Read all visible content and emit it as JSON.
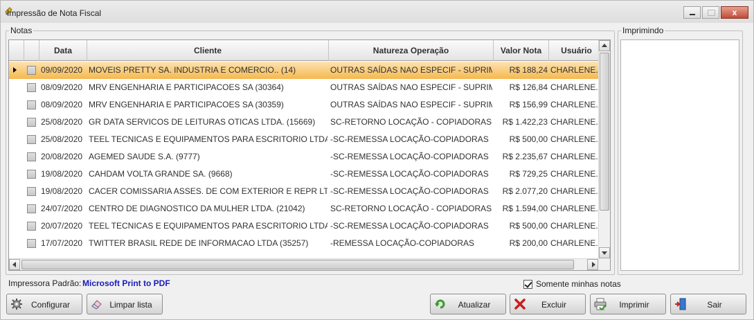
{
  "window": {
    "title": "Impressão de Nota Fiscal",
    "close_label": "x"
  },
  "notas": {
    "legend": "Notas",
    "columns": [
      "Data",
      "Cliente",
      "Natureza Operação",
      "Valor Nota",
      "Usuário"
    ],
    "rows": [
      {
        "data": "09/09/2020",
        "cliente": "MOVEIS PRETTY SA. INDUSTRIA E COMERCIO.. (14)",
        "natureza": "OUTRAS SAÍDAS NAO ESPECIF - SUPRIM...",
        "valor": "R$ 188,24",
        "usuario": "CHARLENE.M"
      },
      {
        "data": "08/09/2020",
        "cliente": "MRV ENGENHARIA E PARTICIPACOES SA (30364)",
        "natureza": "OUTRAS SAÍDAS NAO ESPECIF - SUPRIM...",
        "valor": "R$ 126,84",
        "usuario": "CHARLENE.M"
      },
      {
        "data": "08/09/2020",
        "cliente": "MRV ENGENHARIA E PARTICIPACOES SA  (30359)",
        "natureza": "OUTRAS SAÍDAS NAO ESPECIF - SUPRIM...",
        "valor": "R$ 156,99",
        "usuario": "CHARLENE.M"
      },
      {
        "data": "25/08/2020",
        "cliente": "GR DATA SERVICOS DE LEITURAS OTICAS LTDA. (15669)",
        "natureza": "SC-RETORNO LOCAÇÃO - COPIADORAS...",
        "valor": "R$ 1.422,23",
        "usuario": "CHARLENE.M"
      },
      {
        "data": "25/08/2020",
        "cliente": "TEEL TECNICAS E EQUIPAMENTOS PARA ESCRITORIO LTDA....",
        "natureza": "-SC-REMESSA LOCAÇÃO-COPIADORAS",
        "valor": "R$ 500,00",
        "usuario": "CHARLENE.M"
      },
      {
        "data": "20/08/2020",
        "cliente": "AGEMED SAUDE S.A. (9777)",
        "natureza": "-SC-REMESSA LOCAÇÃO-COPIADORAS",
        "valor": "R$ 2.235,67",
        "usuario": "CHARLENE.M"
      },
      {
        "data": "19/08/2020",
        "cliente": "CAHDAM VOLTA GRANDE SA. (9668)",
        "natureza": "-SC-REMESSA LOCAÇÃO-COPIADORAS",
        "valor": "R$ 729,25",
        "usuario": "CHARLENE.M"
      },
      {
        "data": "19/08/2020",
        "cliente": "CACER COMISSARIA ASSES. DE COM EXTERIOR E REPR LTD....",
        "natureza": "-SC-REMESSA LOCAÇÃO-COPIADORAS",
        "valor": "R$ 2.077,20",
        "usuario": "CHARLENE.M"
      },
      {
        "data": "24/07/2020",
        "cliente": "CENTRO DE DIAGNOSTICO DA MULHER LTDA. (21042)",
        "natureza": "SC-RETORNO LOCAÇÃO - COPIADORAS...",
        "valor": "R$ 1.594,00",
        "usuario": "CHARLENE.M"
      },
      {
        "data": "20/07/2020",
        "cliente": "TEEL TECNICAS E EQUIPAMENTOS PARA ESCRITORIO LTDA....",
        "natureza": "-SC-REMESSA LOCAÇÃO-COPIADORAS",
        "valor": "R$ 500,00",
        "usuario": "CHARLENE.M"
      },
      {
        "data": "17/07/2020",
        "cliente": "TWITTER BRASIL REDE DE INFORMACAO LTDA (35257)",
        "natureza": "-REMESSA LOCAÇÃO-COPIADORAS",
        "valor": "R$ 200,00",
        "usuario": "CHARLENE.M"
      }
    ]
  },
  "imprimindo": {
    "legend": "Imprimindo"
  },
  "printer": {
    "label": "Impressora Padrão:",
    "value": "Microsoft Print to PDF"
  },
  "only_mine": {
    "label": "Somente minhas notas",
    "checked": true
  },
  "buttons": {
    "configurar": "Configurar",
    "limpar": "Limpar lista",
    "atualizar": "Atualizar",
    "excluir": "Excluir",
    "imprimir": "Imprimir",
    "sair": "Sair"
  },
  "colors": {
    "selected_row": "#f5b84f",
    "printer_value": "#1a1ab8",
    "excluir_icon": "#c81e1e",
    "atualizar_icon": "#3a9a2a"
  },
  "icons": [
    "app-icon",
    "gear-icon",
    "eraser-icon",
    "refresh-icon",
    "delete-x-icon",
    "printer-icon",
    "exit-door-icon"
  ]
}
